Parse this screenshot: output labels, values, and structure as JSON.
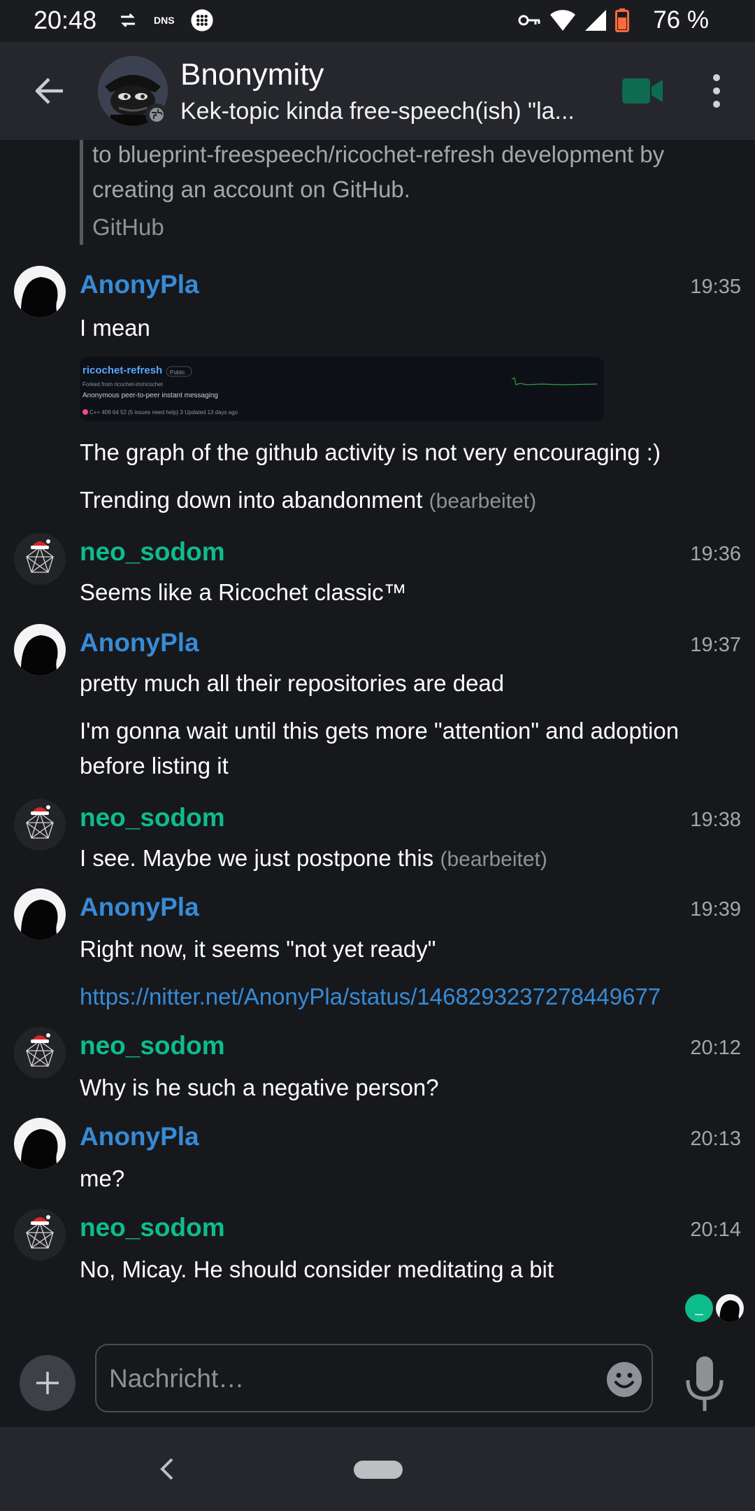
{
  "status_bar": {
    "time": "20:48",
    "dns_label": "DNS",
    "battery": "76 %",
    "icons": [
      "data-saver-icon",
      "dns-icon",
      "app-grid-icon",
      "vpn-key-icon",
      "wifi-icon",
      "signal-icon",
      "battery-icon"
    ]
  },
  "header": {
    "title": "Bnonymity",
    "topic": "Kek-topic kinda free-speech(ish) \"la...",
    "icons": [
      "back-arrow-icon",
      "video-call-icon",
      "more-vert-icon"
    ]
  },
  "timeline": {
    "quote_text": "to blueprint-freespeech/ricochet-refresh development by creating an account on GitHub.",
    "quote_site": "GitHub",
    "messages": [
      {
        "sender": "AnonyPla",
        "time": "19:35",
        "lines": [
          "I mean"
        ]
      },
      {
        "preview_alt": "ricochet-refresh repository screenshot",
        "preview": {
          "name": "ricochet-refresh",
          "visibility": "Public",
          "forked": "Forked from ricochet-im/ricochet",
          "desc": "Anonymous peer-to-peer instant messaging",
          "stats": "C++   409   64   52 (5 issues need help)   3   Updated 13 days ago"
        }
      },
      {
        "text": "The graph of the github activity is not very encouraging :)"
      },
      {
        "text": "Trending down into abandonment",
        "edited": "(bearbeitet)"
      },
      {
        "sender": "neo_sodom",
        "time": "19:36",
        "text": "Seems like a Ricochet classic™"
      },
      {
        "sender": "AnonyPla",
        "time": "19:37",
        "text": "pretty much all their repositories are dead"
      },
      {
        "text": "I'm gonna wait until this gets more \"attention\" and adoption before listing it"
      },
      {
        "sender": "neo_sodom",
        "time": "19:38",
        "text": "I see. Maybe we just postpone this",
        "edited": "(bearbeitet)"
      },
      {
        "sender": "AnonyPla",
        "time": "19:39",
        "text": "Right now, it seems \"not yet ready\""
      },
      {
        "link": "https://nitter.net/AnonyPla/status/1468293237278449677"
      },
      {
        "sender": "neo_sodom",
        "time": "20:12",
        "text": "Why is he such a negative person?"
      },
      {
        "sender": "AnonyPla",
        "time": "20:13",
        "text": "me?"
      },
      {
        "sender": "neo_sodom",
        "time": "20:14",
        "text": "No, Micay. He should consider meditating a bit"
      }
    ],
    "read_receipt_initial": "_"
  },
  "composer": {
    "placeholder": "Nachricht…",
    "icons": [
      "add-icon",
      "emoji-icon",
      "microphone-icon"
    ]
  },
  "colors": {
    "background": "#17181c",
    "header": "#25272c",
    "sender_blue": "#368bd6",
    "sender_green": "#0dbd8b",
    "link": "#368bd6",
    "timestamp": "#a3a6ab"
  }
}
